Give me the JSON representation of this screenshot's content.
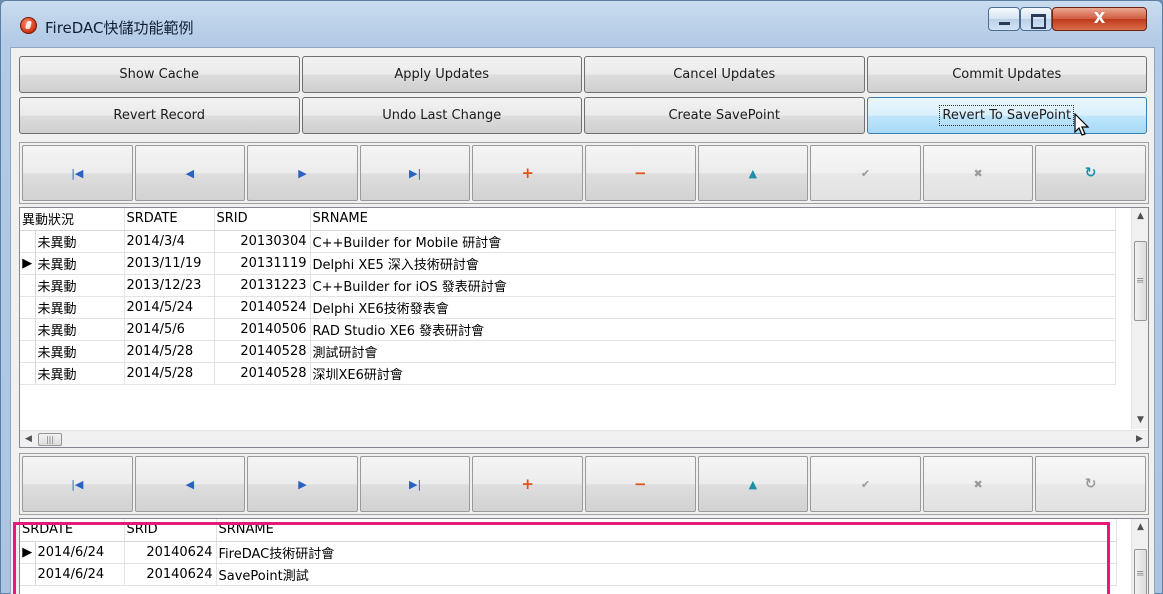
{
  "window": {
    "title": "FireDAC快儲功能範例",
    "close_glyph": "X"
  },
  "buttons_row1": [
    "Show Cache",
    "Apply Updates",
    "Cancel Updates",
    "Commit Updates"
  ],
  "buttons_row2": [
    "Revert Record",
    "Undo Last Change",
    "Create SavePoint",
    "Revert To SavePoint"
  ],
  "navigator": {
    "buttons": [
      {
        "name": "first-record",
        "glyph": "◀",
        "state": "enabled"
      },
      {
        "name": "prior-record",
        "glyph": "◀",
        "state": "enabled"
      },
      {
        "name": "next-record",
        "glyph": "▶",
        "state": "enabled"
      },
      {
        "name": "last-record",
        "glyph": "▶",
        "state": "enabled"
      },
      {
        "name": "insert-record",
        "glyph": "+",
        "state": "enabled"
      },
      {
        "name": "delete-record",
        "glyph": "−",
        "state": "enabled"
      },
      {
        "name": "edit-record",
        "glyph": "▲",
        "state": "enabled"
      },
      {
        "name": "post-edit",
        "glyph": "✔",
        "state": "disabled"
      },
      {
        "name": "cancel-edit",
        "glyph": "✖",
        "state": "disabled"
      },
      {
        "name": "refresh-data",
        "glyph": "↻",
        "state": "enabled"
      }
    ]
  },
  "grid1": {
    "columns": [
      "異動狀況",
      "SRDATE",
      "SRID",
      "SRNAME"
    ],
    "rows": [
      {
        "status": "未異動",
        "srdate": "2014/3/4",
        "srid": "20130304",
        "srname": "C++Builder for Mobile 研討會",
        "current": false
      },
      {
        "status": "未異動",
        "srdate": "2013/11/19",
        "srid": "20131119",
        "srname": "Delphi XE5 深入技術研討會",
        "current": true
      },
      {
        "status": "未異動",
        "srdate": "2013/12/23",
        "srid": "20131223",
        "srname": "C++Builder for iOS 發表研討會",
        "current": false
      },
      {
        "status": "未異動",
        "srdate": "2014/5/24",
        "srid": "20140524",
        "srname": "Delphi XE6技術發表會",
        "current": false
      },
      {
        "status": "未異動",
        "srdate": "2014/5/6",
        "srid": "20140506",
        "srname": "RAD Studio XE6 發表研討會",
        "current": false
      },
      {
        "status": "未異動",
        "srdate": "2014/5/28",
        "srid": "20140528",
        "srname": "測試研討會",
        "current": false
      },
      {
        "status": "未異動",
        "srdate": "2014/5/28",
        "srid": "20140528",
        "srname": "深圳XE6研討會",
        "current": false
      }
    ]
  },
  "grid2": {
    "columns": [
      "SRDATE",
      "SRID",
      "SRNAME"
    ],
    "rows": [
      {
        "srdate": "2014/6/24",
        "srid": "20140624",
        "srname": "FireDAC技術研討會",
        "current": true
      },
      {
        "srdate": "2014/6/24",
        "srid": "20140624",
        "srname": "SavePoint測試",
        "current": false
      }
    ]
  },
  "colors": {
    "highlight_border": "#e5197a",
    "focused_button": "#bee6fd",
    "nav_insert": "#e0531b",
    "nav_first_prior_next_last": "#2a62c2",
    "nav_edit": "#1d8fa8"
  }
}
